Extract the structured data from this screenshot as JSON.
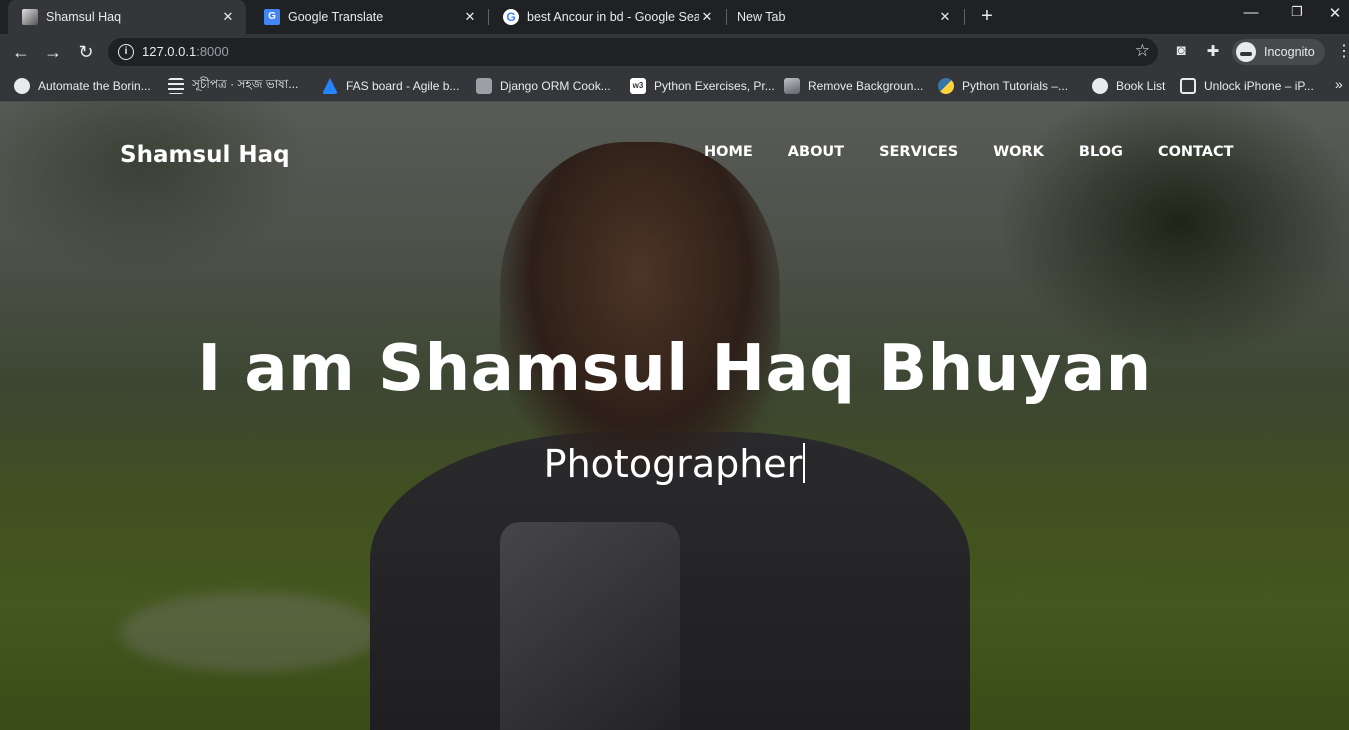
{
  "browser": {
    "tabs": [
      {
        "title": "Shamsul Haq",
        "active": true,
        "favicon": "photo-favicon"
      },
      {
        "title": "Google Translate",
        "active": false,
        "favicon": "google-translate-favicon"
      },
      {
        "title": "best Ancour in bd - Google Search",
        "active": false,
        "favicon": "google-favicon"
      },
      {
        "title": "New Tab",
        "active": false,
        "favicon": ""
      }
    ],
    "url_host": "127.0.0.1",
    "url_port": ":8000",
    "profile_label": "Incognito",
    "bookmarks": [
      {
        "label": "Automate the Borin...",
        "icon": "globe-icon"
      },
      {
        "label": "সূচীপত্র · সহজ ভাষা...",
        "icon": "lines-icon"
      },
      {
        "label": "FAS board - Agile b...",
        "icon": "jira-icon"
      },
      {
        "label": "Django ORM Cook...",
        "icon": "book-icon"
      },
      {
        "label": "Python Exercises, Pr...",
        "icon": "w3-icon"
      },
      {
        "label": "Remove Backgroun...",
        "icon": "layers-icon"
      },
      {
        "label": "Python Tutorials –...",
        "icon": "python-icon"
      },
      {
        "label": "Book List",
        "icon": "globe-icon"
      },
      {
        "label": "Unlock iPhone – iP...",
        "icon": "unlock-icon"
      }
    ]
  },
  "site": {
    "brand": "Shamsul Haq",
    "nav": [
      "HOME",
      "ABOUT",
      "SERVICES",
      "WORK",
      "BLOG",
      "CONTACT"
    ],
    "hero_title": "I am Shamsul Haq Bhuyan",
    "hero_subtitle": "Photographer"
  }
}
